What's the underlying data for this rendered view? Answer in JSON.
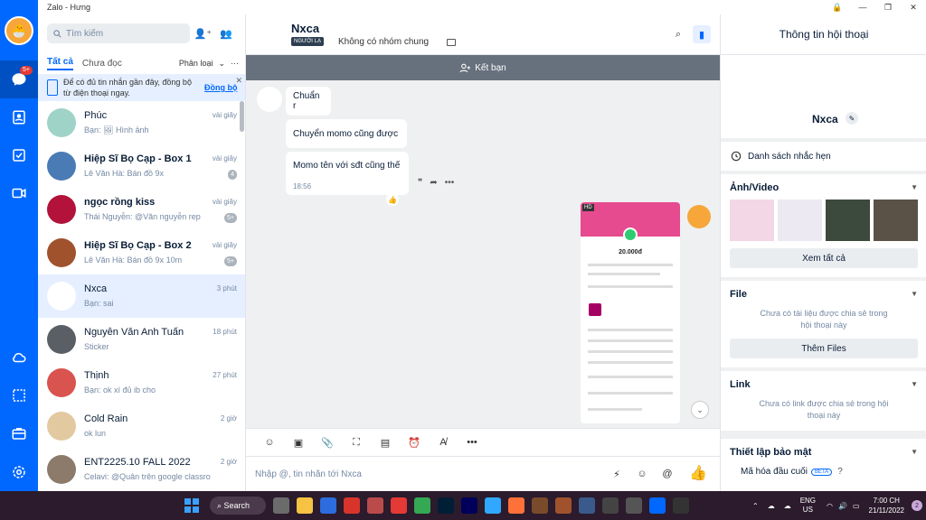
{
  "window": {
    "title": "Zalo - Hưng",
    "colors": {
      "accent": "#0068ff",
      "rail": "#0068ff",
      "banner_bg": "#e5efff",
      "add_friend_bar": "#67717d"
    }
  },
  "rail": {
    "message_badge": "5+",
    "icons": [
      "message-icon",
      "contacts-icon",
      "todo-icon",
      "video-icon",
      "cloud-icon",
      "screenshot-icon",
      "briefcase-icon",
      "settings-icon"
    ]
  },
  "list": {
    "search_placeholder": "Tìm kiếm",
    "tabs": {
      "all": "Tất cả",
      "unread": "Chưa đọc",
      "classify": "Phân loại",
      "more": "···"
    },
    "banner": {
      "text": "Để có đủ tin nhắn gần đây, đồng bộ từ điện thoại ngay.",
      "action": "Đồng bộ"
    },
    "conversations": [
      {
        "name": "Phúc",
        "time": "vài giây",
        "preview": "Bạn: 🖼 Hình ảnh",
        "count": "",
        "bold": false
      },
      {
        "name": "Hiệp Sĩ Bọ Cạp - Box 1",
        "time": "vài giây",
        "preview": "Lê Văn Hà: Bán đồ 9x",
        "count": "4",
        "bold": true
      },
      {
        "name": "ngọc rồng kiss",
        "time": "vài giây",
        "preview": "Thái Nguyễn: @Văn nguyễn rep",
        "count": "5+",
        "bold": true
      },
      {
        "name": "Hiệp Sĩ Bọ Cạp - Box 2",
        "time": "vài giây",
        "preview": "Lê Văn Hà: Bán đồ 9x 10m",
        "count": "5+",
        "bold": true
      },
      {
        "name": "Nxca",
        "time": "3 phút",
        "preview": "Bạn: sai",
        "count": "",
        "bold": false
      },
      {
        "name": "Nguyễn Văn Anh Tuấn",
        "time": "18 phút",
        "preview": "Sticker",
        "count": "",
        "bold": false
      },
      {
        "name": "Thịnh",
        "time": "27 phút",
        "preview": "Bạn: ok xí đủ ib cho",
        "count": "",
        "bold": false
      },
      {
        "name": "Cold Rain",
        "time": "2 giờ",
        "preview": "ok lun",
        "count": "",
        "bold": false
      },
      {
        "name": "ENT2225.10 FALL 2022",
        "time": "2 giờ",
        "preview": "Celavi: @Quân trên google classro...",
        "count": "",
        "bold": false
      }
    ]
  },
  "chat": {
    "name": "Nxca",
    "tag": "NGƯỜI LẠ",
    "groups": "Không có nhóm chung",
    "add_friend": "Kết bạn",
    "messages": [
      {
        "text": "Chuẩn r",
        "time": ""
      },
      {
        "text": "Chuyển momo cũng được",
        "time": ""
      },
      {
        "text": "Momo tên với sđt cũng thế",
        "time": "18:56"
      }
    ],
    "image": {
      "badge": "HD",
      "amount": "20.000đ"
    },
    "composer_placeholder": "Nhập @, tin nhắn tới Nxca"
  },
  "info": {
    "title": "Thông tin hội thoại",
    "name": "Nxca",
    "reminders": "Danh sách nhắc hẹn",
    "media": {
      "title": "Ảnh/Video",
      "see_all": "Xem tất cả"
    },
    "files": {
      "title": "File",
      "empty": "Chưa có tài liệu được chia sẻ trong hội thoại này",
      "add": "Thêm Files"
    },
    "links": {
      "title": "Link",
      "empty": "Chưa có link được chia sẻ trong hội thoại này"
    },
    "security": {
      "title": "Thiết lập bảo mật",
      "e2e": "Mã hóa đầu cuối",
      "beta": "BETA"
    }
  },
  "taskbar": {
    "search": "Search",
    "lang1": "ENG",
    "lang2": "US",
    "time": "7:00 CH",
    "date": "21/11/2022",
    "notifications": "2"
  }
}
